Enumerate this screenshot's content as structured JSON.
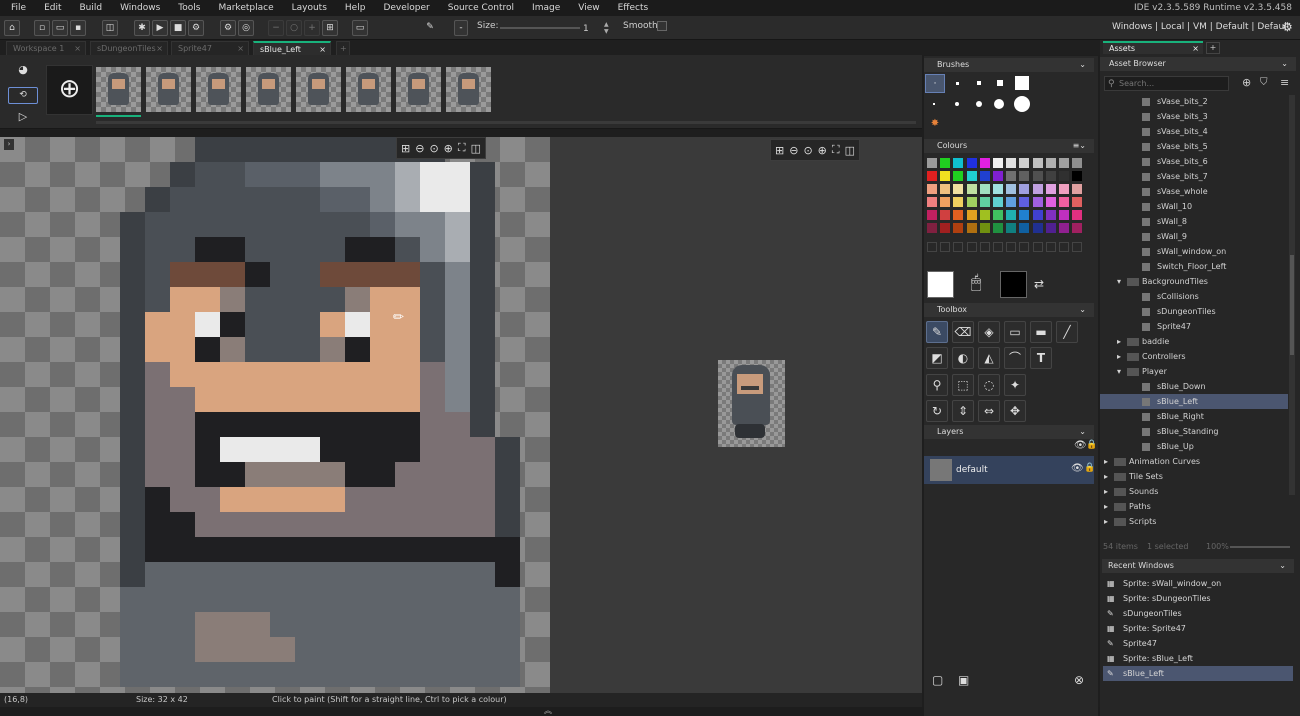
{
  "menu": [
    "File",
    "Edit",
    "Build",
    "Windows",
    "Tools",
    "Marketplace",
    "Layouts",
    "Help",
    "Developer",
    "Source Control",
    "Image",
    "View",
    "Effects"
  ],
  "version": "IDE v2.3.5.589  Runtime v2.3.5.458",
  "toolbar": {
    "size_label": "Size:",
    "size_value": "1",
    "smooth_label": "Smooth",
    "target": "Windows | Local | VM | Default | Default"
  },
  "tabs": [
    {
      "label": "Workspace 1"
    },
    {
      "label": "sDungeonTiles"
    },
    {
      "label": "Sprite47"
    },
    {
      "label": "sBlue_Left",
      "active": true
    }
  ],
  "add_tab": "+",
  "frames_count": 8,
  "status": {
    "coords": "(16,8)",
    "size": "Size: 32 x 42",
    "hint": "Click to paint (Shift for a straight line, Ctrl to pick a colour)"
  },
  "panels": {
    "brushes": "Brushes",
    "colours": "Colours",
    "toolbox": "Toolbox",
    "layers": "Layers",
    "layer_name": "default"
  },
  "assets": {
    "tab_label": "Assets",
    "browser_title": "Asset Browser",
    "search_placeholder": "Search...",
    "items": [
      {
        "label": "sVase_bits_2",
        "indent": 2
      },
      {
        "label": "sVase_bits_3",
        "indent": 2
      },
      {
        "label": "sVase_bits_4",
        "indent": 2
      },
      {
        "label": "sVase_bits_5",
        "indent": 2
      },
      {
        "label": "sVase_bits_6",
        "indent": 2
      },
      {
        "label": "sVase_bits_7",
        "indent": 2
      },
      {
        "label": "sVase_whole",
        "indent": 2
      },
      {
        "label": "sWall_10",
        "indent": 2
      },
      {
        "label": "sWall_8",
        "indent": 2
      },
      {
        "label": "sWall_9",
        "indent": 2
      },
      {
        "label": "sWall_window_on",
        "indent": 2
      },
      {
        "label": "Switch_Floor_Left",
        "indent": 2
      },
      {
        "label": "BackgroundTiles",
        "indent": 1,
        "folder": true,
        "open": true
      },
      {
        "label": "sCollisions",
        "indent": 2
      },
      {
        "label": "sDungeonTiles",
        "indent": 2
      },
      {
        "label": "Sprite47",
        "indent": 2
      },
      {
        "label": "baddie",
        "indent": 1,
        "folder": true
      },
      {
        "label": "Controllers",
        "indent": 1,
        "folder": true
      },
      {
        "label": "Player",
        "indent": 1,
        "folder": true,
        "open": true
      },
      {
        "label": "sBlue_Down",
        "indent": 2
      },
      {
        "label": "sBlue_Left",
        "indent": 2,
        "selected": true
      },
      {
        "label": "sBlue_Right",
        "indent": 2
      },
      {
        "label": "sBlue_Standing",
        "indent": 2
      },
      {
        "label": "sBlue_Up",
        "indent": 2
      },
      {
        "label": "Animation Curves",
        "indent": 0,
        "folder": true
      },
      {
        "label": "Tile Sets",
        "indent": 0,
        "folder": true
      },
      {
        "label": "Sounds",
        "indent": 0,
        "folder": true
      },
      {
        "label": "Paths",
        "indent": 0,
        "folder": true
      },
      {
        "label": "Scripts",
        "indent": 0,
        "folder": true
      }
    ],
    "footer": {
      "count": "54 items",
      "selected": "1 selected",
      "zoom": "100%"
    }
  },
  "recent": {
    "title": "Recent Windows",
    "items": [
      {
        "label": "Sprite: sWall_window_on"
      },
      {
        "label": "Sprite: sDungeonTiles"
      },
      {
        "label": "sDungeonTiles"
      },
      {
        "label": "Sprite: Sprite47"
      },
      {
        "label": "Sprite47"
      },
      {
        "label": "Sprite: sBlue_Left"
      },
      {
        "label": "sBlue_Left",
        "selected": true
      }
    ]
  },
  "colors": {
    "accent": "#19b27c",
    "selection": "#4b5670"
  }
}
